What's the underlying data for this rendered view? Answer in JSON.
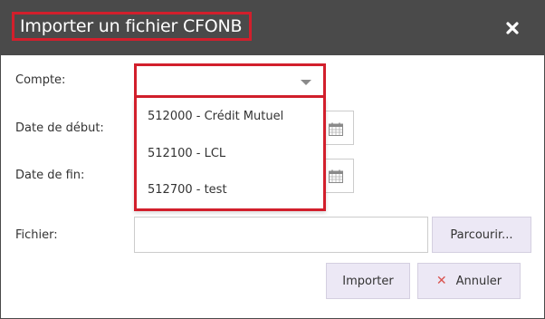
{
  "dialog": {
    "title": "Importer un fichier CFONB",
    "close_icon": "close-icon"
  },
  "form": {
    "account_label": "Compte:",
    "account_value": "",
    "account_options": [
      "512000 - Crédit Mutuel",
      "512100 - LCL",
      "512700 - test"
    ],
    "start_date_label": "Date de début:",
    "end_date_label": "Date de fin:",
    "file_label": "Fichier:",
    "browse_label": "Parcourir...",
    "calendar_icon": "calendar-icon"
  },
  "actions": {
    "import_label": "Importer",
    "cancel_label": "Annuler",
    "cancel_icon": "x-icon"
  },
  "colors": {
    "titlebar": "#4a4a4a",
    "highlight": "#d21f2c",
    "button_bg": "#ece8f5",
    "cancel_x": "#d9534f"
  }
}
